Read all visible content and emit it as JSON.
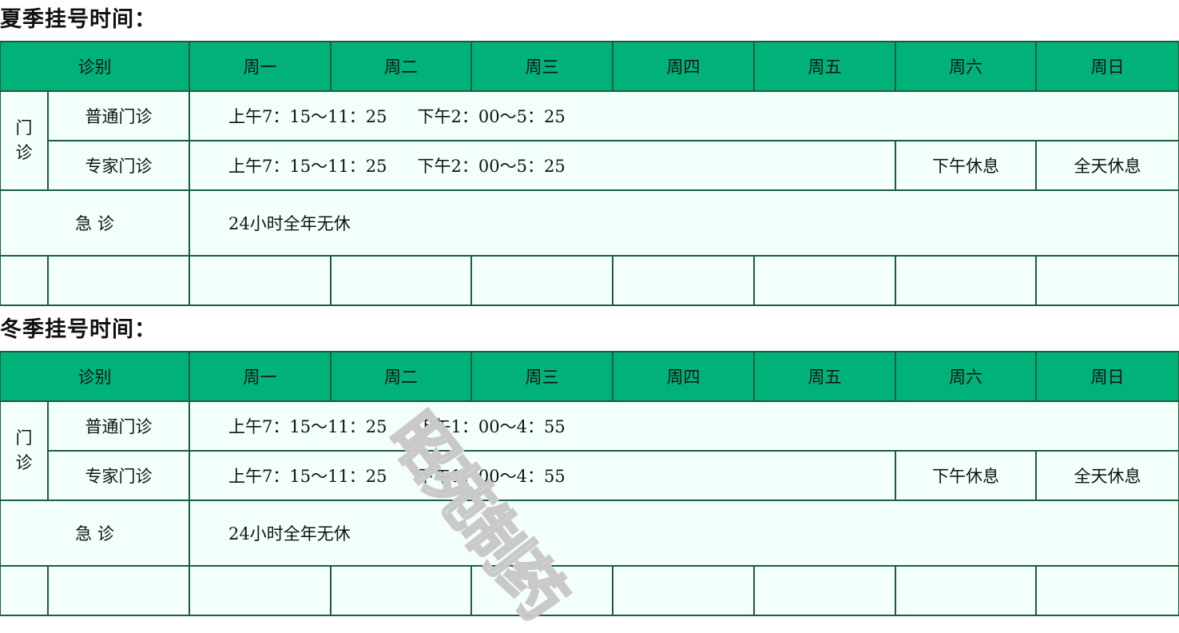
{
  "summer": {
    "title": "夏季挂号时间：",
    "headers": [
      "诊别",
      "周一",
      "周二",
      "周三",
      "周四",
      "周五",
      "周六",
      "周日"
    ],
    "outpatient_label": [
      "门",
      "诊"
    ],
    "rows": {
      "general": {
        "label": "普通门诊",
        "morning": "上午7：15～11：25",
        "afternoon": "下午2：00～5：25"
      },
      "expert": {
        "label": "专家门诊",
        "morning": "上午7：15～11：25",
        "afternoon": "下午2：00～5：25",
        "saturday": "下午休息",
        "sunday": "全天休息"
      },
      "emergency": {
        "label": "急 诊",
        "hours": "24小时全年无休"
      }
    }
  },
  "winter": {
    "title": "冬季挂号时间：",
    "headers": [
      "诊别",
      "周一",
      "周二",
      "周三",
      "周四",
      "周五",
      "周六",
      "周日"
    ],
    "outpatient_label": [
      "门",
      "诊"
    ],
    "rows": {
      "general": {
        "label": "普通门诊",
        "morning": "上午7：15～11：25",
        "afternoon": "下午1：00～4：55"
      },
      "expert": {
        "label": "专家门诊",
        "morning": "上午7：15～11：25",
        "afternoon": "下午1：00～4：55",
        "saturday": "下午休息",
        "sunday": "全天休息"
      },
      "emergency": {
        "label": "急 诊",
        "hours": "24小时全年无休"
      }
    }
  },
  "watermark": "昭苑制药",
  "colors": {
    "header_bg": "#00b27a",
    "border": "#1b5e3e",
    "cell_bg": "#f3fffb"
  }
}
